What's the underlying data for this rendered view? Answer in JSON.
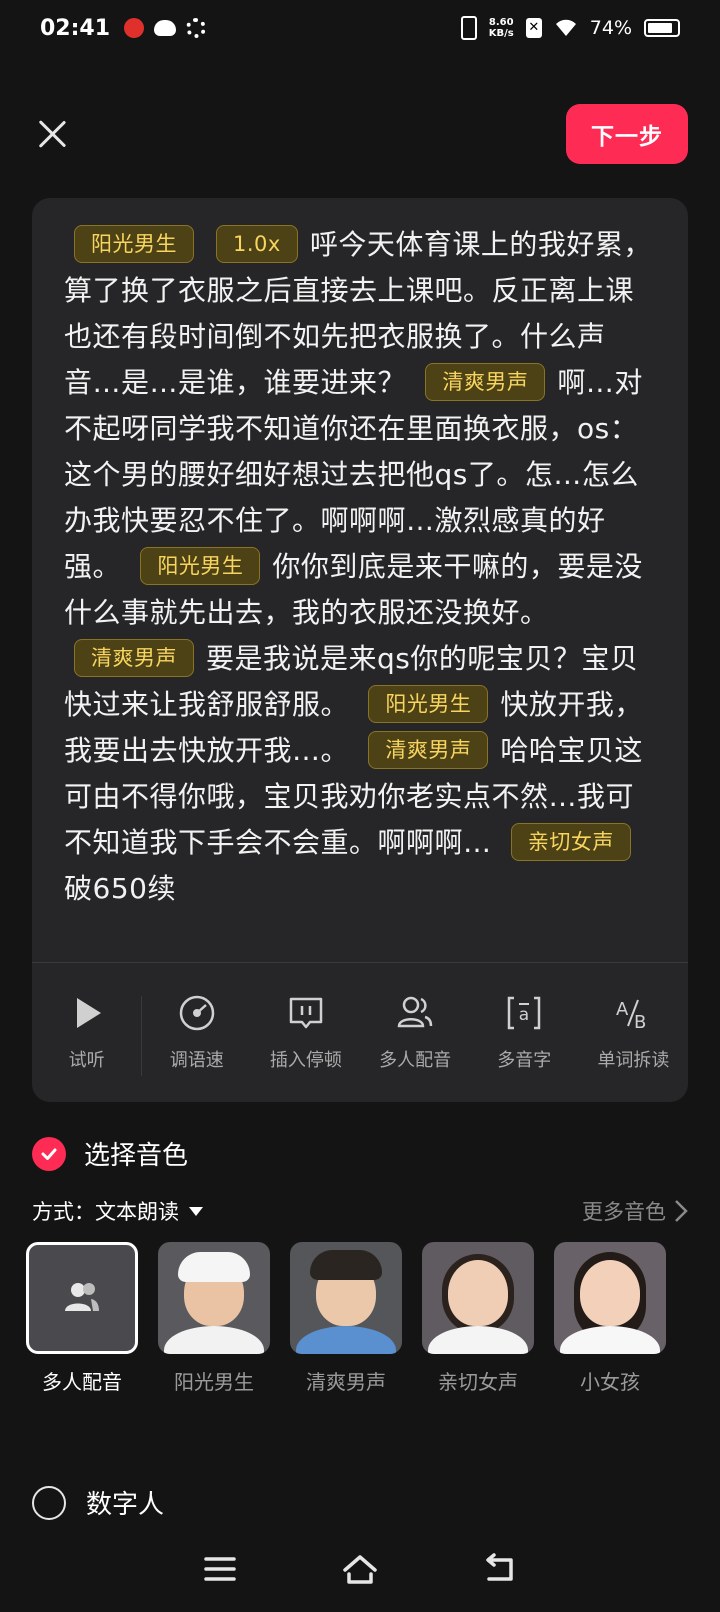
{
  "status": {
    "time": "02:41",
    "net_speed_value": "8.60",
    "net_speed_unit": "KB/s",
    "battery": "74%",
    "battery_level": 0.74
  },
  "header": {
    "next_label": "下一步"
  },
  "script": {
    "segments": [
      {
        "voice": "阳光男生",
        "speed": "1.0x",
        "text": "呼今天体育课上的我好累，算了换了衣服之后直接去上课吧。反正离上课也还有段时间倒不如先把衣服换了。什么声音…是…是谁，谁要进来？"
      },
      {
        "voice": "清爽男声",
        "text": "啊…对不起呀同学我不知道你还在里面换衣服，os：这个男的腰好细好想过去把他qs了。怎…怎么办我快要忍不住了。啊啊啊…激烈感真的好强。"
      },
      {
        "voice": "阳光男生",
        "text": "你你到底是来干嘛的，要是没什么事就先出去，我的衣服还没换好。"
      },
      {
        "voice": "清爽男声",
        "text": "要是我说是来qs你的呢宝贝？宝贝快过来让我舒服舒服。"
      },
      {
        "voice": "阳光男生",
        "text": "快放开我，我要出去快放开我…。"
      },
      {
        "voice": "清爽男声",
        "text": "哈哈宝贝这可由不得你哦，宝贝我劝你老实点不然…我可不知道我下手会不会重。啊啊啊…"
      },
      {
        "voice": "亲切女声",
        "text": "破650续"
      }
    ]
  },
  "tools": [
    {
      "label": "试听",
      "icon": "play-icon"
    },
    {
      "label": "调语速",
      "icon": "speed-dial-icon"
    },
    {
      "label": "插入停顿",
      "icon": "pause-insert-icon"
    },
    {
      "label": "多人配音",
      "icon": "multi-user-icon"
    },
    {
      "label": "多音字",
      "icon": "polyphone-icon"
    },
    {
      "label": "单词拆读",
      "icon": "ab-split-icon"
    }
  ],
  "voice_section": {
    "title": "选择音色",
    "mode_prefix": "方式：",
    "mode_value": "文本朗读",
    "more_label": "更多音色",
    "voices": [
      {
        "name": "多人配音",
        "selected": true
      },
      {
        "name": "阳光男生"
      },
      {
        "name": "清爽男声"
      },
      {
        "name": "亲切女声"
      },
      {
        "name": "小女孩"
      }
    ]
  },
  "digital_human": {
    "label": "数字人"
  }
}
